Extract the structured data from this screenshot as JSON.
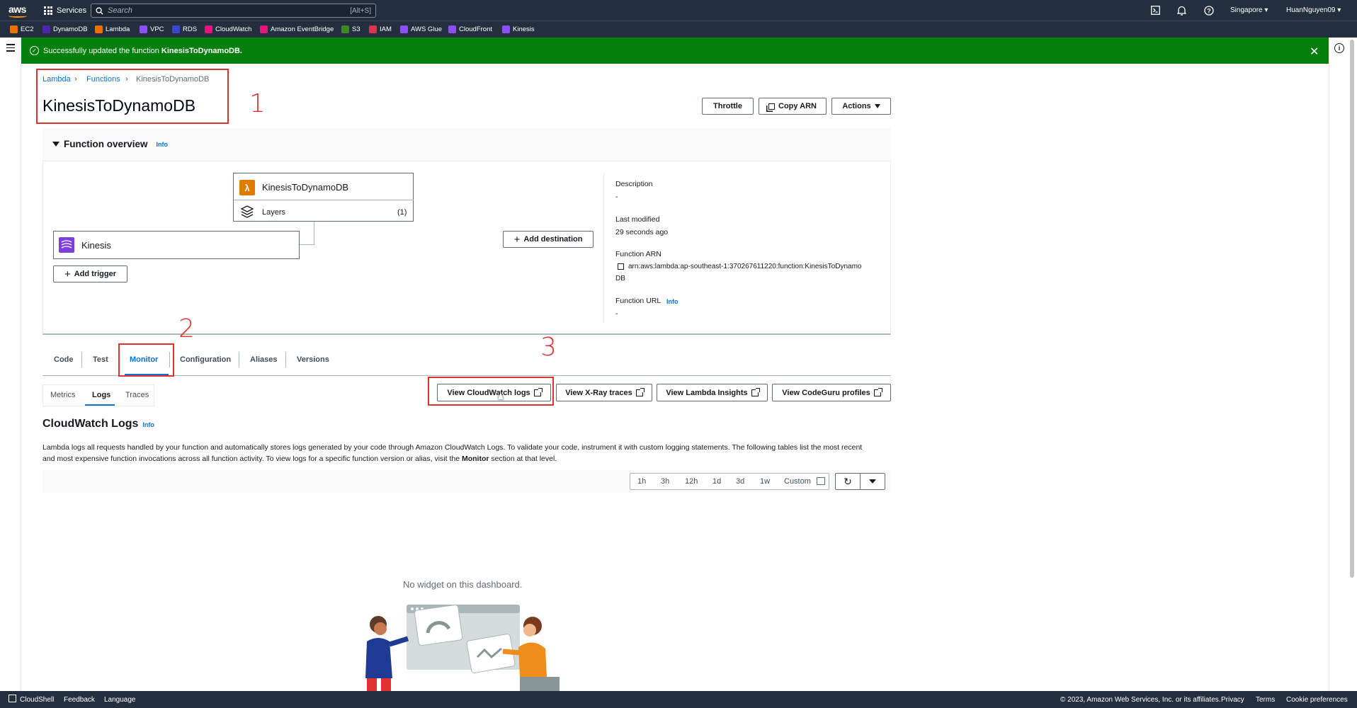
{
  "nav": {
    "services_label": "Services",
    "search_placeholder": "Search",
    "search_shortcut": "[Alt+S]",
    "region": "Singapore",
    "account": "HuanNguyen09"
  },
  "favorites": [
    {
      "label": "EC2",
      "color": "#ed7100"
    },
    {
      "label": "DynamoDB",
      "color": "#4d27aa"
    },
    {
      "label": "Lambda",
      "color": "#ed7100"
    },
    {
      "label": "VPC",
      "color": "#8c4fff"
    },
    {
      "label": "RDS",
      "color": "#3b48cc"
    },
    {
      "label": "CloudWatch",
      "color": "#e7157b"
    },
    {
      "label": "Amazon EventBridge",
      "color": "#e7157b"
    },
    {
      "label": "S3",
      "color": "#3f8624"
    },
    {
      "label": "IAM",
      "color": "#dd344c"
    },
    {
      "label": "AWS Glue",
      "color": "#8c4fff"
    },
    {
      "label": "CloudFront",
      "color": "#8c4fff"
    },
    {
      "label": "Kinesis",
      "color": "#8c4fff"
    }
  ],
  "banner": {
    "text": "Successfully updated the function",
    "function": "KinesisToDynamoDB."
  },
  "breadcrumb": [
    "Lambda",
    "Functions",
    "KinesisToDynamoDB"
  ],
  "page_title": "KinesisToDynamoDB",
  "header_buttons": {
    "throttle": "Throttle",
    "copy_arn": "Copy ARN",
    "actions": "Actions"
  },
  "annotations": [
    "1",
    "2",
    "3"
  ],
  "overview": {
    "title": "Function overview",
    "info": "Info",
    "function_name": "KinesisToDynamoDB",
    "layers_label": "Layers",
    "layers_count": "(1)",
    "trigger": "Kinesis",
    "add_trigger": "Add trigger",
    "add_destination": "Add destination",
    "description_label": "Description",
    "description_value": "-",
    "last_modified_label": "Last modified",
    "last_modified_value": "29 seconds ago",
    "arn_label": "Function ARN",
    "arn_value_1": "arn:aws:lambda:ap-southeast-1:370267611220:function:KinesisToDynamo",
    "arn_value_2": "DB",
    "url_label": "Function URL",
    "url_info": "Info",
    "url_value": "-"
  },
  "tabs": [
    "Code",
    "Test",
    "Monitor",
    "Configuration",
    "Aliases",
    "Versions"
  ],
  "active_tab": "Monitor",
  "subtabs": [
    "Metrics",
    "Logs",
    "Traces"
  ],
  "active_subtab": "Logs",
  "view_buttons": {
    "cloudwatch": "View CloudWatch logs",
    "xray": "View X-Ray traces",
    "insights": "View Lambda Insights",
    "codeguru": "View CodeGuru profiles"
  },
  "logs": {
    "title": "CloudWatch Logs",
    "info": "Info",
    "desc_1": "Lambda logs all requests handled by your function and automatically stores logs generated by your code through Amazon CloudWatch Logs. To validate your code, instrument it with custom logging statements. The following tables list the most recent",
    "desc_2": "and most expensive function invocations across all function activity. To view logs for a specific function version or alias, visit the",
    "desc_monitor": "Monitor",
    "desc_3": "section at that level."
  },
  "ranges": [
    "1h",
    "3h",
    "12h",
    "1d",
    "3d",
    "1w",
    "Custom"
  ],
  "empty_message": "No widget on this dashboard.",
  "footer": {
    "cloudshell": "CloudShell",
    "feedback": "Feedback",
    "language": "Language",
    "copyright": "© 2023, Amazon Web Services, Inc. or its affiliates.",
    "privacy": "Privacy",
    "terms": "Terms",
    "cookies": "Cookie preferences"
  }
}
